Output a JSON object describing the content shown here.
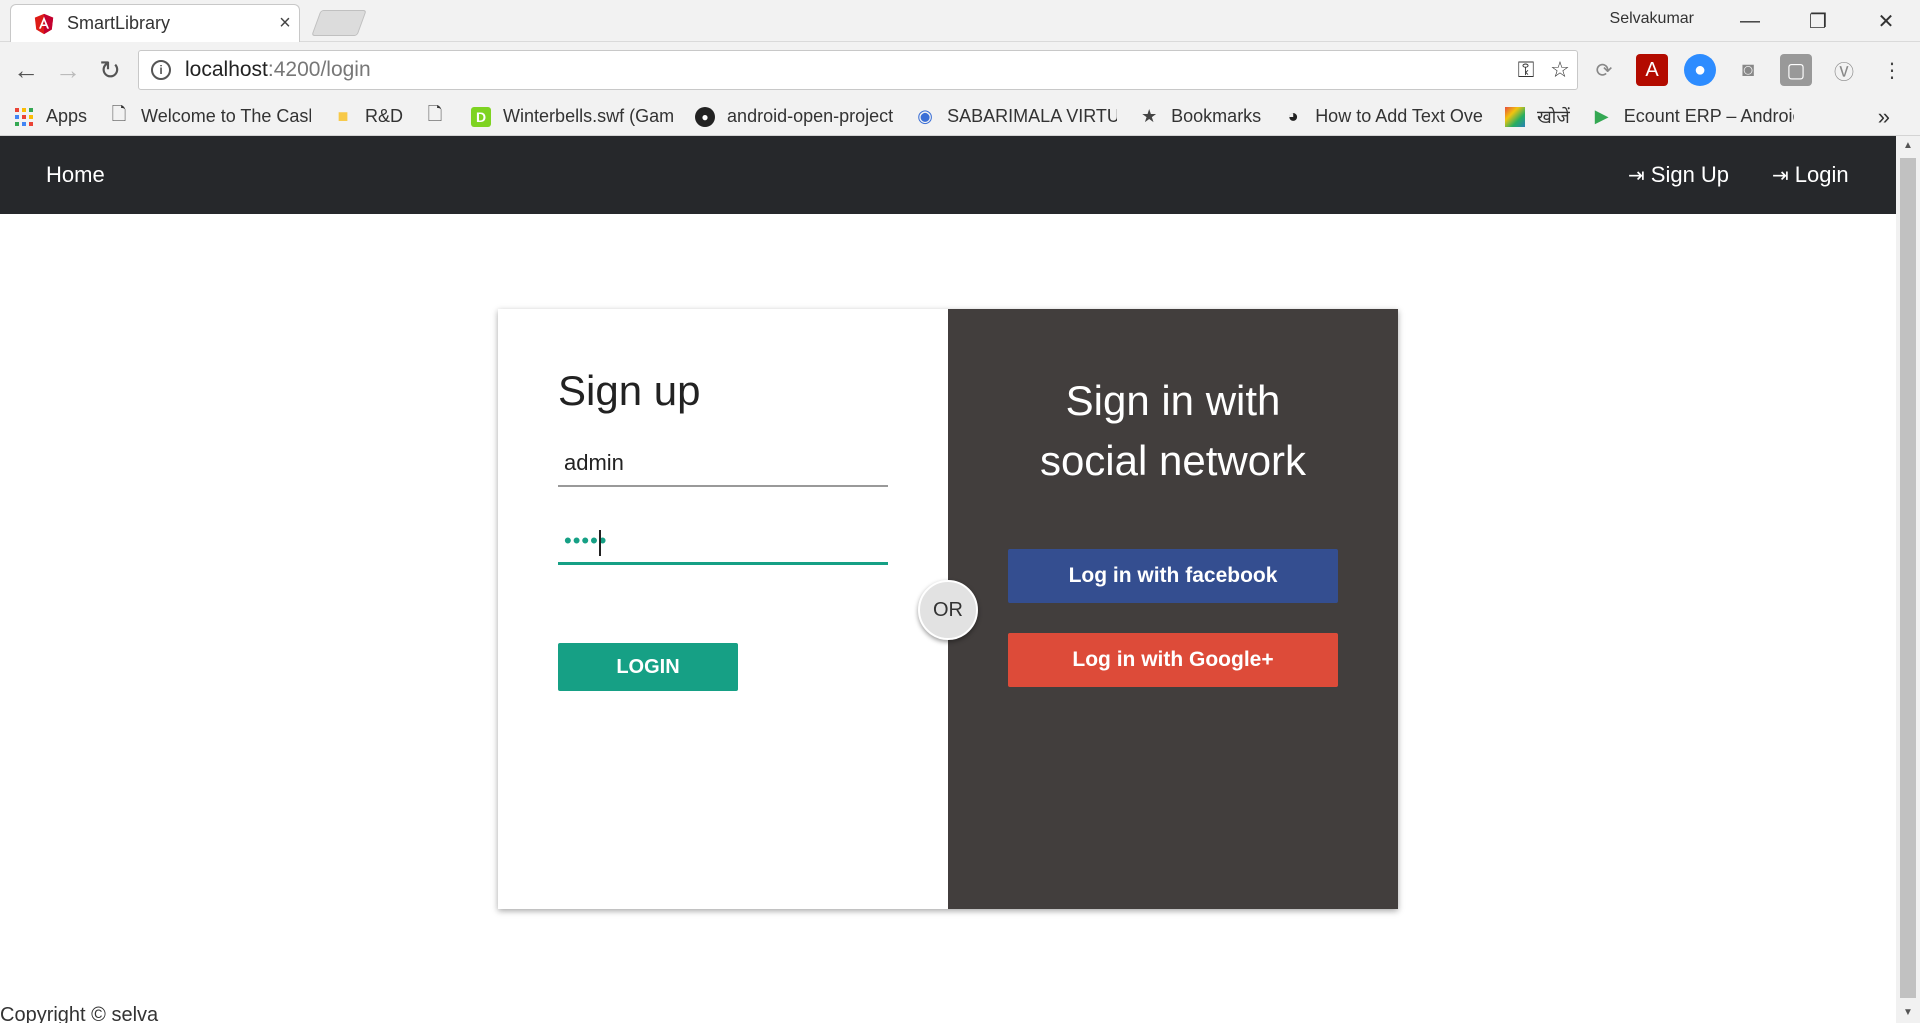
{
  "browser": {
    "tab_title": "SmartLibrary",
    "tab_close": "×",
    "profile_name": "Selvakumar",
    "url_host": "localhost",
    "url_path": ":4200/login",
    "bookmarks": [
      {
        "label": "Apps",
        "icon": "apps-grid-icon"
      },
      {
        "label": "Welcome to The Cash",
        "icon": "page-icon"
      },
      {
        "label": "R&D",
        "icon": "folder-icon"
      },
      {
        "label": "",
        "icon": "page-icon"
      },
      {
        "label": "Winterbells.swf (Gam",
        "icon": "game-icon"
      },
      {
        "label": "android-open-project",
        "icon": "github-icon"
      },
      {
        "label": "SABARIMALA VIRTUA",
        "icon": "map-pin-icon"
      },
      {
        "label": "Bookmarks",
        "icon": "star-icon"
      },
      {
        "label": "How to Add Text Ove",
        "icon": "pie-icon"
      },
      {
        "label": "खोजें",
        "icon": "colorful-square-icon"
      },
      {
        "label": "Ecount ERP – Androic",
        "icon": "play-store-icon"
      }
    ],
    "bookmarks_more": "»"
  },
  "navbar": {
    "home": "Home",
    "signup": "Sign Up",
    "login": "Login"
  },
  "signup_panel": {
    "title": "Sign up",
    "username_value": "admin",
    "password_value": "•••••",
    "login_button": "LOGIN"
  },
  "divider": {
    "or_label": "OR"
  },
  "social_panel": {
    "title_line1": "Sign in with",
    "title_line2": "social network",
    "facebook_button": "Log in with facebook",
    "google_button": "Log in with Google+"
  },
  "footer": {
    "copyright": "Copyright © selva"
  },
  "colors": {
    "navbar_bg": "#26282b",
    "accent_green": "#16a085",
    "social_panel_bg": "#423e3d",
    "facebook_blue": "#344e90",
    "google_red": "#dd4b39"
  }
}
